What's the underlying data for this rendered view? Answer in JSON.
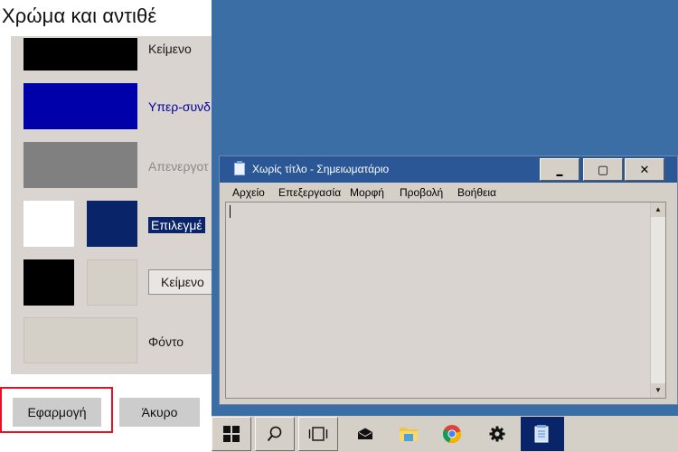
{
  "colors": {
    "desktop": "#3a6ea5",
    "text_swatch": "#000000",
    "hyperlink_swatch": "#0000aa",
    "disabled_swatch": "#808080",
    "selected_bg_swatch": "#ffffff",
    "selected_text_swatch": "#0a246a",
    "button_text_swatch": "#000000",
    "button_face_swatch": "#d4d0c8",
    "background_swatch": "#d4d0c8",
    "highlight_border": "#e81123"
  },
  "settings": {
    "title": "Χρώμα και αντιθέ",
    "rows": {
      "text_label": "Κείμενο",
      "hyperlink_label": "Υπερ-συνδ",
      "disabled_label": "Απενεργοτ",
      "selected_label": "Επιλεγμέ",
      "button_text_label": "Κείμενο",
      "background_label": "Φόντο"
    },
    "apply_label": "Εφαρμογή",
    "cancel_label": "Άκυρο"
  },
  "notepad": {
    "title": "Χωρίς τίτλο - Σημειωματάριο",
    "minimize_glyph": "▬",
    "maximize_glyph": "▢",
    "close_glyph": "✕",
    "menu": [
      "Αρχείο",
      "Επεξεργασία",
      "Μορφή",
      "Προβολή",
      "Βοήθεια"
    ],
    "content": ""
  },
  "taskbar": {
    "icons": [
      "windows-start-icon",
      "search-icon",
      "task-view-icon",
      "mail-icon",
      "file-explorer-icon",
      "chrome-icon",
      "gear-icon",
      "notepad-icon"
    ]
  }
}
